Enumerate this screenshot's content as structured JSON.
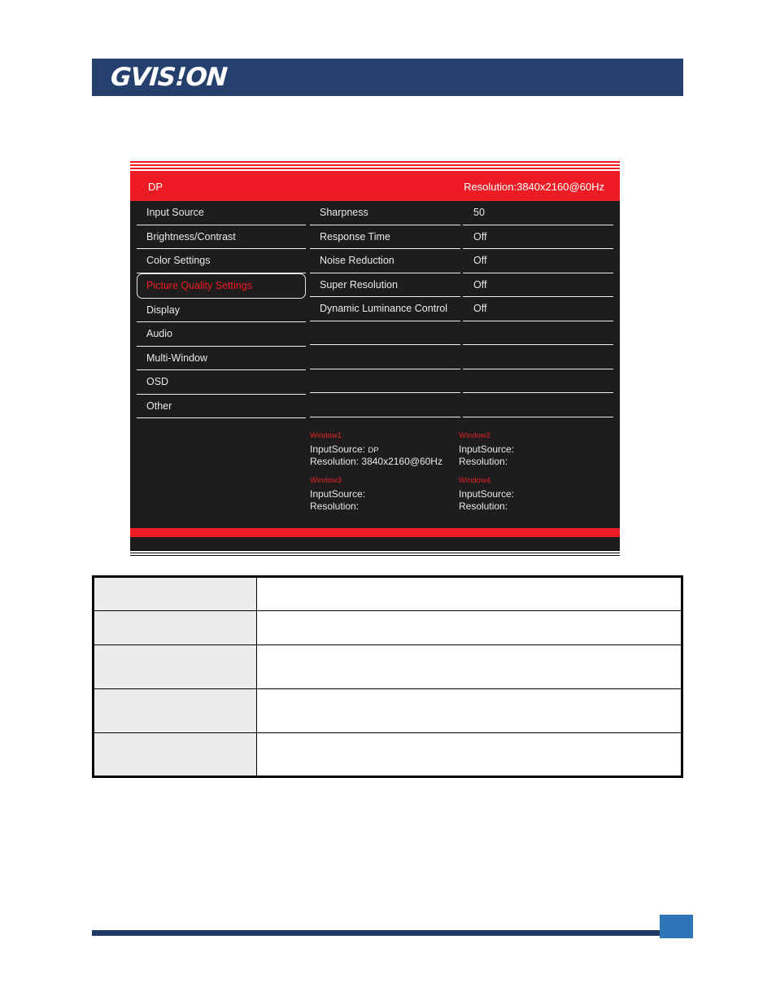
{
  "page": {
    "brand": "GVIS!ON"
  },
  "osd": {
    "source": "DP",
    "resolution_label": "Resolution:3840x2160@60Hz",
    "menu": [
      {
        "label": "Input Source",
        "selected": false
      },
      {
        "label": "Brightness/Contrast",
        "selected": false
      },
      {
        "label": "Color Settings",
        "selected": false
      },
      {
        "label": "Picture Quality Settings",
        "selected": true
      },
      {
        "label": "Display",
        "selected": false
      },
      {
        "label": "Audio",
        "selected": false
      },
      {
        "label": "Multi-Window",
        "selected": false
      },
      {
        "label": "OSD",
        "selected": false
      },
      {
        "label": "Other",
        "selected": false
      }
    ],
    "items": [
      "Sharpness",
      "Response Time",
      "Noise Reduction",
      "Super Resolution",
      "Dynamic Luminance Control",
      "",
      "",
      "",
      ""
    ],
    "values": [
      "50",
      "Off",
      "Off",
      "Off",
      "Off",
      "",
      "",
      "",
      ""
    ],
    "windows": [
      {
        "title": "Window1",
        "input_source_label": "InputSource:",
        "input_source_value": "DP",
        "resolution_label": "Resolution:",
        "resolution_value": "3840x2160@60Hz"
      },
      {
        "title": "Window2",
        "input_source_label": "InputSource:",
        "input_source_value": "",
        "resolution_label": "Resolution:",
        "resolution_value": ""
      },
      {
        "title": "Window3",
        "input_source_label": "InputSource:",
        "input_source_value": "",
        "resolution_label": "Resolution:",
        "resolution_value": ""
      },
      {
        "title": "Window4",
        "input_source_label": "InputSource:",
        "input_source_value": "",
        "resolution_label": "Resolution:",
        "resolution_value": ""
      }
    ]
  },
  "description_table": {
    "rows": [
      {
        "key": "",
        "value": ""
      },
      {
        "key": "",
        "value": ""
      },
      {
        "key": "",
        "value": ""
      },
      {
        "key": "",
        "value": ""
      },
      {
        "key": "",
        "value": ""
      }
    ]
  },
  "footer": {
    "page_number": ""
  },
  "colors": {
    "brand_navy": "#26406e",
    "osd_red": "#ed1c24",
    "osd_background": "#1e1c1c",
    "table_key_fill": "#ebebeb",
    "footer_rule": "#1f3864",
    "footer_box": "#2e75b6"
  }
}
